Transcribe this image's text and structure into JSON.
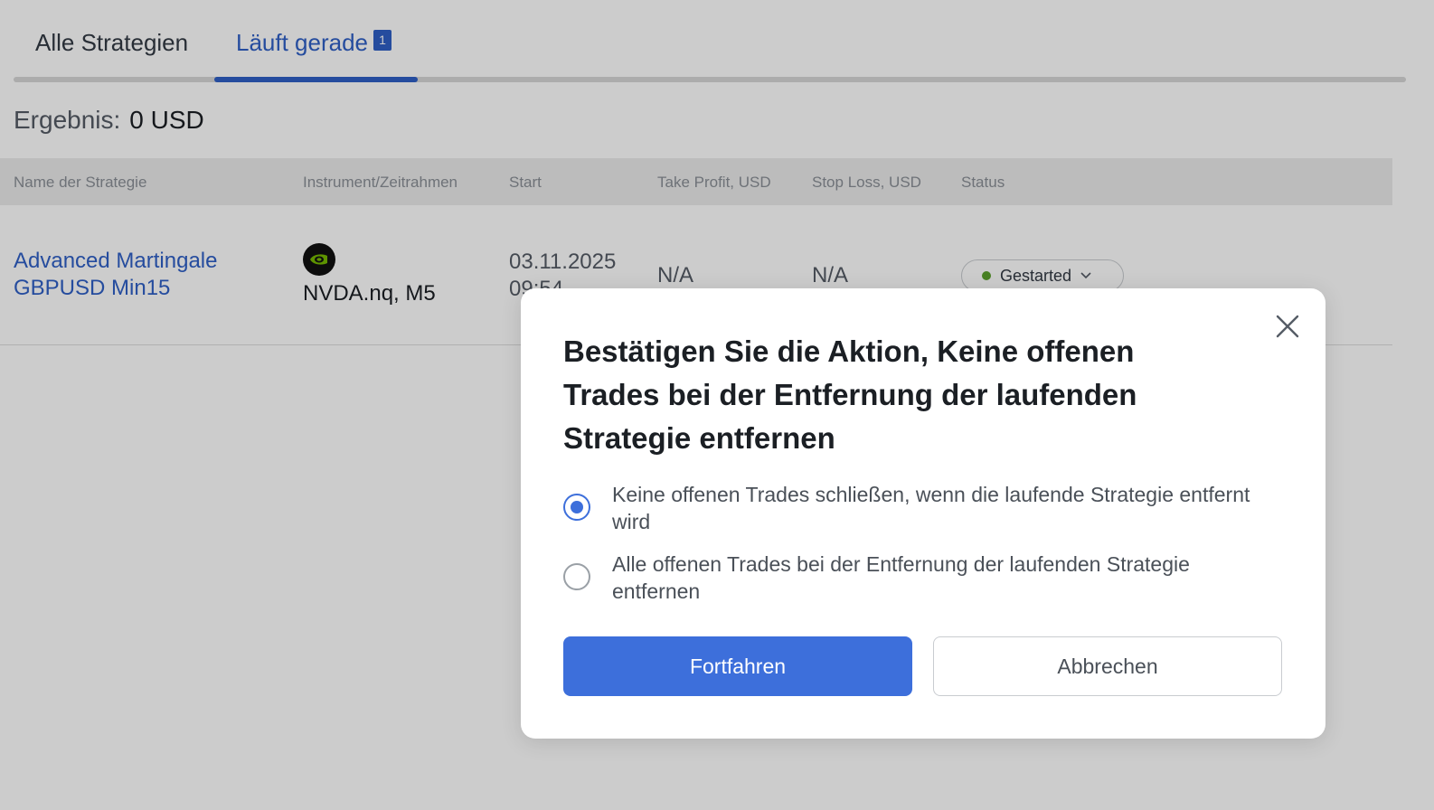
{
  "tabs": [
    {
      "label": "Alle Strategien"
    },
    {
      "label": "Läuft gerade",
      "badge": "1"
    }
  ],
  "result": {
    "label": "Ergebnis:",
    "value": "0 USD"
  },
  "table": {
    "columns": [
      "Name der Strategie",
      "Instrument/Zeitrahmen",
      "Start",
      "Take Profit, USD",
      "Stop Loss, USD",
      "Status"
    ],
    "rows": [
      {
        "name": "Advanced Martingale GBPUSD Min15",
        "instrument_icon": "nvidia-logo-icon",
        "instrument": "NVDA.nq, M5",
        "start": "03.11.2025 09:54",
        "take_profit": "N/A",
        "stop_loss": "N/A",
        "status": "Gestarted"
      }
    ]
  },
  "modal": {
    "title": "Bestätigen Sie die Aktion, Keine offenen Trades bei der Entfernung der laufenden Strategie entfernen",
    "options": [
      {
        "label": "Keine offenen Trades schließen, wenn die laufende Strategie entfernt wird",
        "selected": true
      },
      {
        "label": "Alle offenen Trades bei der Entfernung der laufenden Strategie entfernen",
        "selected": false
      }
    ],
    "confirm_label": "Fortfahren",
    "cancel_label": "Abbrechen"
  },
  "colors": {
    "accent": "#3d6fdb",
    "link": "#2f5fc6",
    "status_dot": "#5aa02c"
  }
}
